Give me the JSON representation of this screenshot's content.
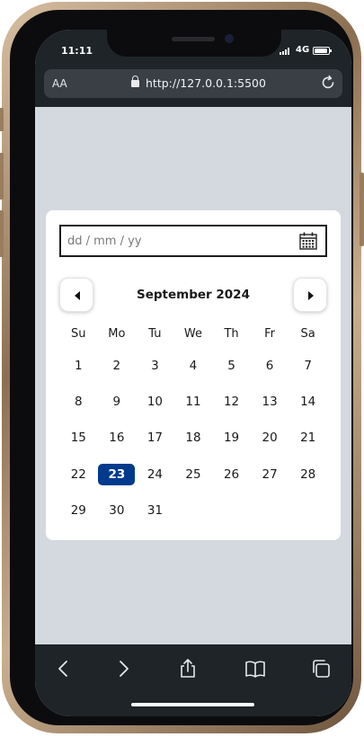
{
  "status_bar": {
    "time": "11:11",
    "network": "4G"
  },
  "browser": {
    "text_size_label": "AA",
    "url": "http://127.0.0.1:5500"
  },
  "date_input": {
    "placeholder": "dd / mm / yy",
    "value": ""
  },
  "calendar": {
    "month_title": "September 2024",
    "weekdays": [
      "Su",
      "Mo",
      "Tu",
      "We",
      "Th",
      "Fr",
      "Sa"
    ],
    "weeks": [
      [
        "1",
        "2",
        "3",
        "4",
        "5",
        "6",
        "7"
      ],
      [
        "8",
        "9",
        "10",
        "11",
        "12",
        "13",
        "14"
      ],
      [
        "15",
        "16",
        "17",
        "18",
        "19",
        "20",
        "21"
      ],
      [
        "22",
        "23",
        "24",
        "25",
        "26",
        "27",
        "28"
      ],
      [
        "29",
        "30",
        "31",
        "",
        "",
        "",
        ""
      ]
    ],
    "selected_day": "23",
    "selected_color": "#003a8c"
  },
  "icons": {
    "prev": "chevron-left-icon",
    "next": "chevron-right-icon",
    "calendar": "calendar-icon",
    "toolbar": [
      "back-icon",
      "forward-icon",
      "share-icon",
      "bookmarks-icon",
      "tabs-icon"
    ]
  }
}
